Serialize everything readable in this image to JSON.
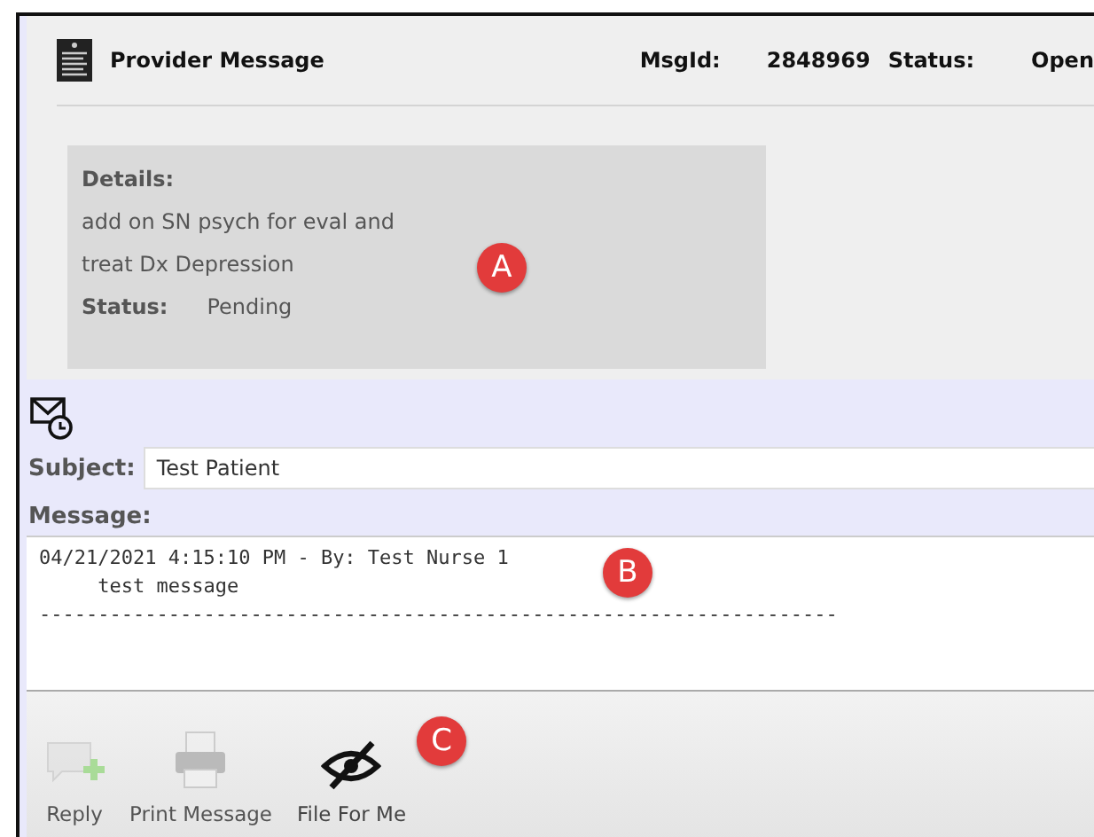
{
  "header": {
    "title": "Provider Message",
    "msg_id_label": "MsgId:",
    "msg_id": "2848969",
    "status_label": "Status:",
    "status": "Open"
  },
  "details": {
    "heading": "Details:",
    "lines": [
      "add on SN psych for eval and",
      "treat Dx Depression"
    ],
    "status_label": "Status:",
    "status": "Pending"
  },
  "subject": {
    "label": "Subject:",
    "value": "Test Patient"
  },
  "message": {
    "label": "Message:",
    "value": "04/21/2021 4:15:10 PM - By: Test Nurse 1\n     test message\n--------------------------------------------------------------------"
  },
  "toolbar": [
    {
      "kind": "reply",
      "label": "Reply",
      "disabled": true
    },
    {
      "kind": "print",
      "label": "Print Message",
      "disabled": true
    },
    {
      "kind": "file",
      "label": "File For Me",
      "disabled": false
    }
  ],
  "markers": [
    "A",
    "B",
    "C"
  ]
}
